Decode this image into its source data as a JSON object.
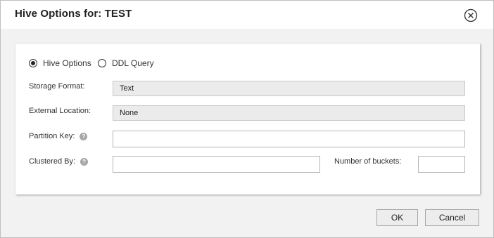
{
  "dialog": {
    "title": "Hive Options for: TEST",
    "close_icon": "close-circle-icon"
  },
  "mode": {
    "options": [
      {
        "label": "Hive Options",
        "selected": true
      },
      {
        "label": "DDL Query",
        "selected": false
      }
    ]
  },
  "fields": {
    "storage_format": {
      "label": "Storage Format:",
      "value": "Text"
    },
    "external_location": {
      "label": "External Location:",
      "value": "None"
    },
    "partition_key": {
      "label": "Partition Key:",
      "value": "",
      "help_icon": "help-icon"
    },
    "clustered_by": {
      "label": "Clustered By:",
      "value": "",
      "help_icon": "help-icon"
    },
    "number_of_buckets": {
      "label": "Number of buckets:",
      "value": ""
    }
  },
  "buttons": {
    "ok": "OK",
    "cancel": "Cancel"
  }
}
